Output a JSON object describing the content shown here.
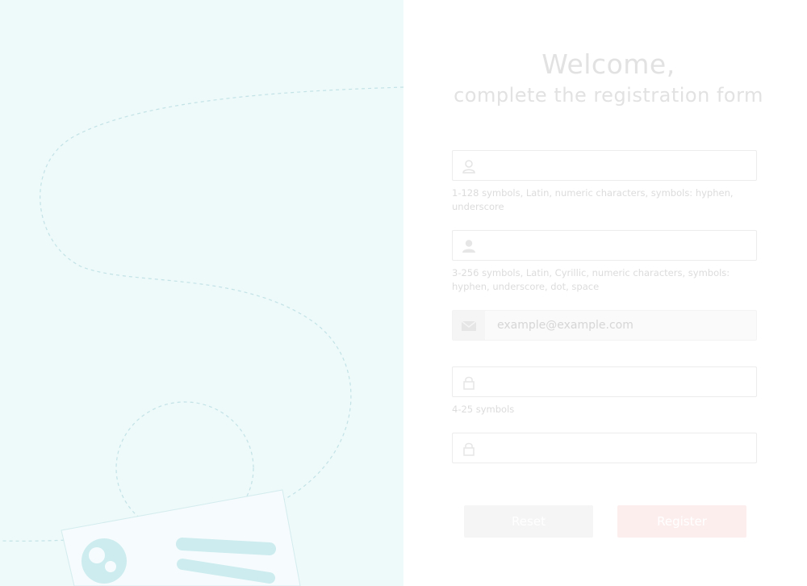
{
  "header": {
    "welcome": "Welcome,",
    "subtitle": "complete the registration form"
  },
  "form": {
    "login": {
      "value": "",
      "placeholder": "",
      "icon": "user-outline-icon",
      "hint": "1-128 symbols, Latin, numeric characters, symbols: hyphen, underscore"
    },
    "name": {
      "value": "",
      "placeholder": "",
      "icon": "user-filled-icon",
      "hint": "3-256 symbols, Latin, Cyrillic, numeric characters, symbols: hyphen, underscore, dot, space"
    },
    "email": {
      "value": "",
      "placeholder": "example@example.com",
      "icon": "envelope-icon"
    },
    "password": {
      "value": "",
      "placeholder": "",
      "icon": "lock-icon",
      "hint": "4-25 symbols"
    },
    "password_confirm": {
      "value": "",
      "placeholder": "",
      "icon": "lock-icon"
    }
  },
  "buttons": {
    "reset": "Reset",
    "register": "Register"
  },
  "colors": {
    "left_panel_bg": "#eef9fa",
    "register_button_bg": "#fdeeee",
    "reset_button_bg": "#f5f5f5"
  }
}
